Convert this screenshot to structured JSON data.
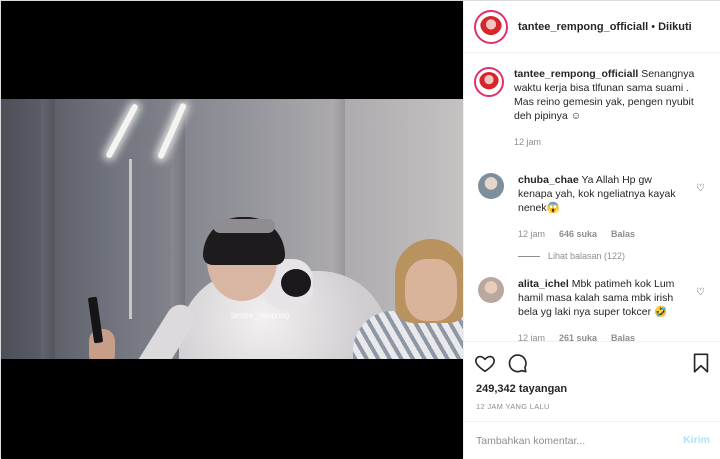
{
  "post": {
    "username": "tantee_rempong_officiall",
    "follow_status": "Diikuti",
    "separator": "•",
    "video_watermark": "tantee_rempong"
  },
  "caption": {
    "username": "tantee_rempong_officiall",
    "text_line1": "Senangnya waktu kerja bisa tlfunan sama suami .",
    "text_line2": "Mas reino gemesin yak, pengen nyubit deh pipinya ☺",
    "time": "12 jam"
  },
  "comments": [
    {
      "username": "chuba_chae",
      "text": "Ya Allah Hp gw kenapa yah, kok ngeliatnya kayak nenek😱",
      "time": "12 jam",
      "likes": "646 suka",
      "reply_label": "Balas",
      "view_replies": "Lihat balasan (122)"
    },
    {
      "username": "alita_ichel",
      "text": "Mbk patimeh kok Lum hamil masa kalah sama mbk irish bela yg laki nya super tokcer 🤣",
      "time": "12 jam",
      "likes": "261 suka",
      "reply_label": "Balas"
    }
  ],
  "stats": {
    "views_count": "249,342",
    "views_label": "tayangan",
    "posted_time": "12 JAM YANG LALU"
  },
  "composer": {
    "placeholder": "Tambahkan komentar...",
    "send_label": "Kirim"
  },
  "colors": {
    "story_ring": "#e1306c",
    "send_disabled": "#b2dffc",
    "muted_text": "#8e8e8e"
  },
  "icons": [
    "heart-icon",
    "comment-icon",
    "bookmark-icon"
  ]
}
